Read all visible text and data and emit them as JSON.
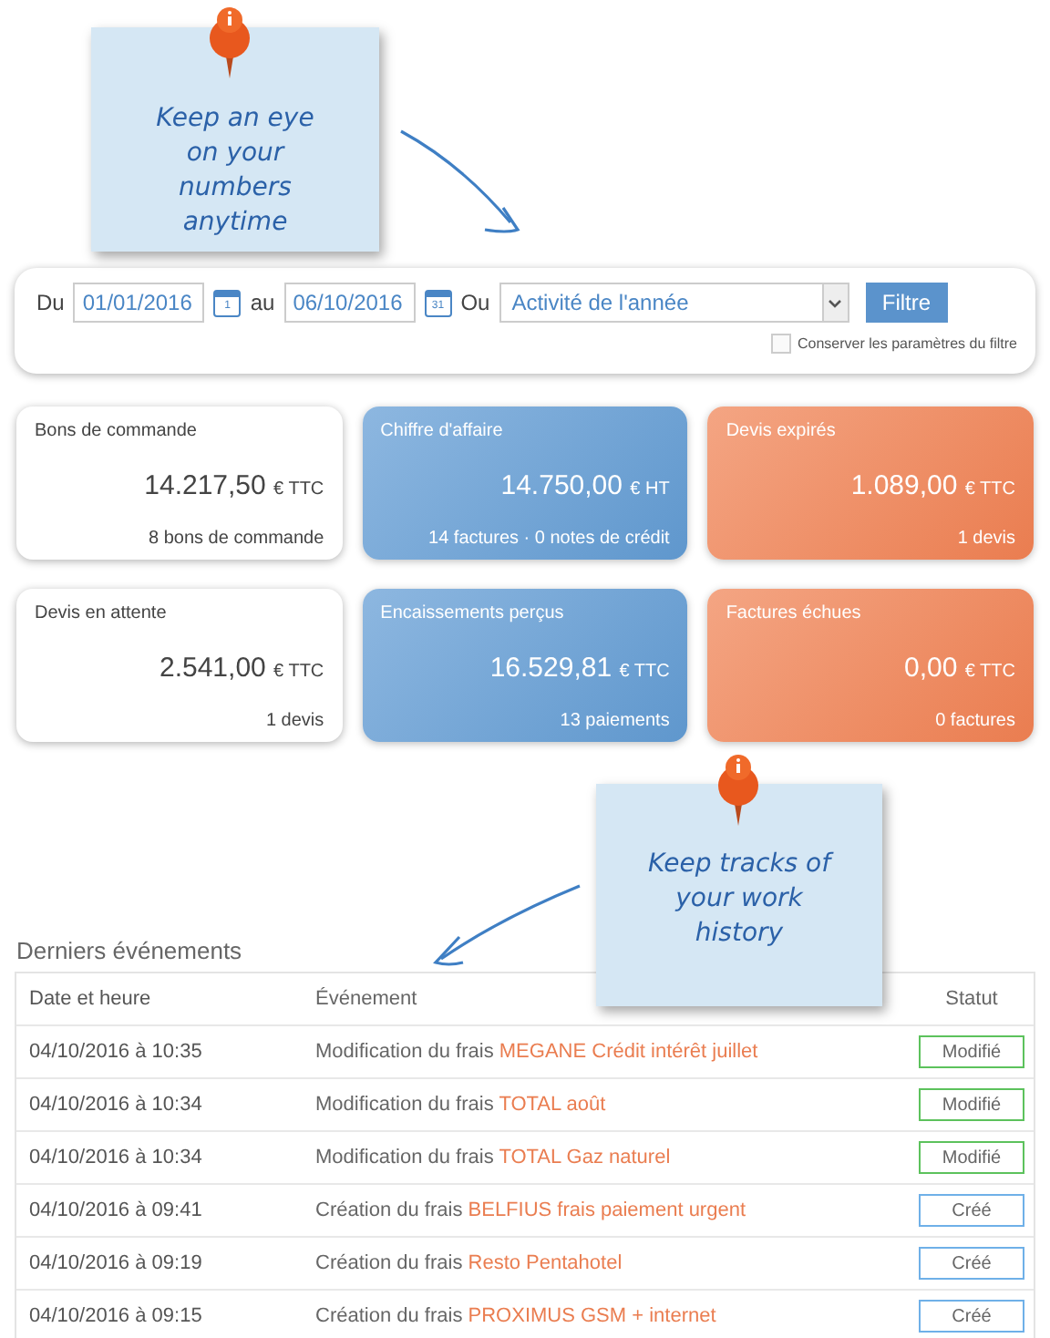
{
  "notes": [
    {
      "text": "Keep an eye on your numbers anytime"
    },
    {
      "text": "Keep tracks of your work history"
    }
  ],
  "filter": {
    "from_label": "Du",
    "from": "01/01/2016",
    "from_day": "1",
    "to_label": "au",
    "to": "06/10/2016",
    "to_day": "31",
    "or_label": "Ou",
    "period": "Activité de l'année",
    "button": "Filtre",
    "keep": {
      "label": "Conserver les paramètres du filtre",
      "checked": false
    }
  },
  "cards": [
    {
      "title": "Bons de commande",
      "amount": "14.217,50",
      "unit": "€ TTC",
      "detail": "8 bons de commande",
      "kind": "plain"
    },
    {
      "title": "Chiffre d'affaire",
      "amount": "14.750,00",
      "unit": "€ HT",
      "detail": "14 factures · 0 notes de crédit",
      "kind": "blue"
    },
    {
      "title": "Devis expirés",
      "amount": "1.089,00",
      "unit": "€ TTC",
      "detail": "1 devis",
      "kind": "orange"
    },
    {
      "title": "Devis en attente",
      "amount": "2.541,00",
      "unit": "€ TTC",
      "detail": "1 devis",
      "kind": "plain"
    },
    {
      "title": "Encaissements perçus",
      "amount": "16.529,81",
      "unit": "€ TTC",
      "detail": "13 paiements",
      "kind": "blue"
    },
    {
      "title": "Factures échues",
      "amount": "0,00",
      "unit": "€ TTC",
      "detail": "0 factures",
      "kind": "orange"
    }
  ],
  "events": {
    "title": "Derniers événements",
    "columns": [
      "Date et heure",
      "Événement",
      "Statut"
    ],
    "rows": [
      {
        "date": "04/10/2016 à 10:35",
        "action": "Modification du frais",
        "subject": "MEGANE Crédit intérêt juillet",
        "status": "Modifié",
        "kind": "modified"
      },
      {
        "date": "04/10/2016 à 10:34",
        "action": "Modification du frais",
        "subject": "TOTAL août",
        "status": "Modifié",
        "kind": "modified"
      },
      {
        "date": "04/10/2016 à 10:34",
        "action": "Modification du frais",
        "subject": "TOTAL Gaz naturel",
        "status": "Modifié",
        "kind": "modified"
      },
      {
        "date": "04/10/2016 à 09:41",
        "action": "Création du frais",
        "subject": "BELFIUS frais paiement urgent",
        "status": "Créé",
        "kind": "created"
      },
      {
        "date": "04/10/2016 à 09:19",
        "action": "Création du frais",
        "subject": "Resto Pentahotel",
        "status": "Créé",
        "kind": "created"
      },
      {
        "date": "04/10/2016 à 09:15",
        "action": "Création du frais",
        "subject": "PROXIMUS GSM + internet",
        "status": "Créé",
        "kind": "created"
      }
    ]
  }
}
